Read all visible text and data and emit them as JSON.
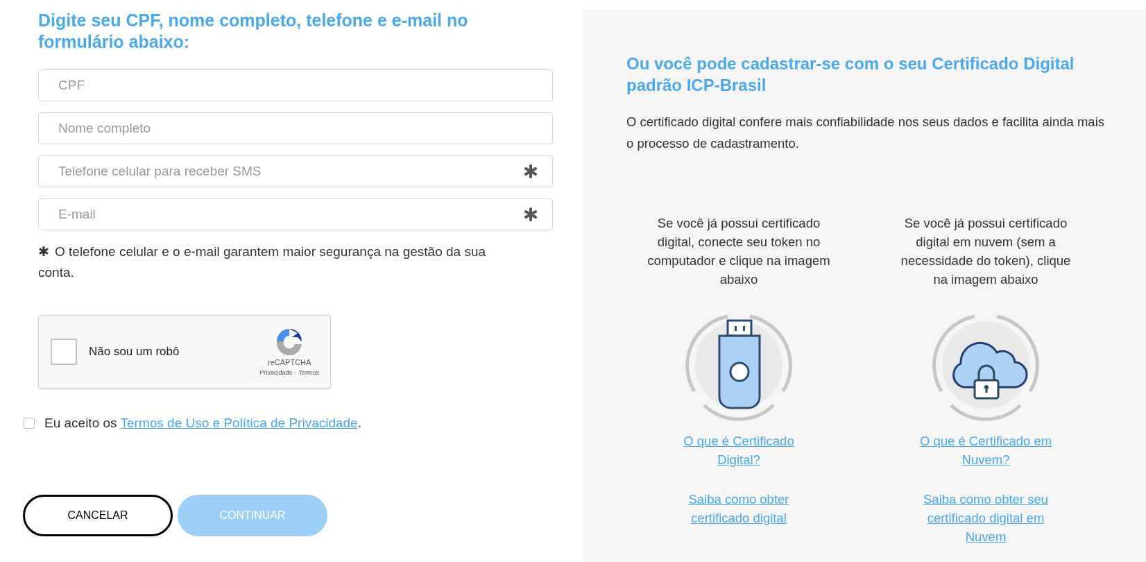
{
  "form": {
    "heading": "Digite seu CPF, nome completo, telefone e e-mail no formulário abaixo:",
    "fields": [
      {
        "placeholder": "CPF",
        "required": false
      },
      {
        "placeholder": "Nome completo",
        "required": false
      },
      {
        "placeholder": "Telefone celular para receber SMS",
        "required": true
      },
      {
        "placeholder": "E-mail",
        "required": true
      }
    ],
    "note_mark": "✱",
    "note": "O telefone celular e o e-mail garantem maior segurança na gestão da sua conta.",
    "captcha": {
      "label": "Não sou um robô",
      "checked": false,
      "brand": "reCAPTCHA",
      "privacy": "Privacidade",
      "separator": "-",
      "terms": "Termos"
    },
    "terms": {
      "checked": false,
      "prefix": "Eu aceito os",
      "link": "Termos de Uso e Política de Privacidade",
      "suffix": "."
    },
    "buttons": [
      {
        "label": "CANCELAR",
        "kind": "outline"
      },
      {
        "label": "CONTINUAR",
        "kind": "primary",
        "disabled": true
      }
    ]
  },
  "certificate": {
    "heading": "Ou você pode cadastrar-se com o seu Certificado Digital padrão ICP-Brasil",
    "description": "O certificado digital confere mais confiabilidade nos seus dados e facilita ainda mais o processo de cadastramento.",
    "options": [
      {
        "kind": "token",
        "text": "Se você já possui certificado digital, conecte seu token no computador e clique na imagem abaixo",
        "links": [
          "O que é Certificado Digital?",
          "Saiba como obter certificado digital"
        ]
      },
      {
        "kind": "cloud",
        "text": "Se você já possui certificado digital em nuvem (sem a necessidade do token), clique na imagem abaixo",
        "links": [
          "O que é Certificado em Nuvem?",
          "Saiba como obter seu certificado digital em Nuvem"
        ]
      }
    ]
  }
}
